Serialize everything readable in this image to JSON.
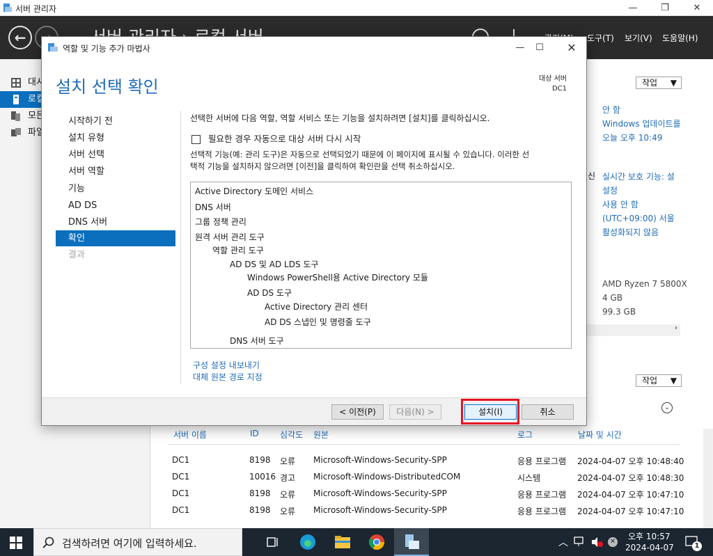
{
  "server_manager": {
    "title": "서버 관리자",
    "breadcrumb_visible": "서버 관리자 › 로컬 서버",
    "menu": [
      "관리(M)",
      "도구(T)",
      "보기(V)",
      "도움말(H)"
    ],
    "nav_items": [
      {
        "label": "대시",
        "icon": "dashboard-icon"
      },
      {
        "label": "로컬",
        "icon": "local-server-icon"
      },
      {
        "label": "모든",
        "icon": "all-servers-icon"
      },
      {
        "label": "파일",
        "icon": "file-services-icon"
      }
    ],
    "task_label": "작업",
    "properties": {
      "col_lines": [
        "안 함",
        "Windows 업데이트를",
        "오늘 오후 10:49"
      ],
      "col_lines_2_prefix": "신",
      "col_lines_2": [
        "실시간 보호 기능: 설",
        "설정",
        "사용 안 함",
        "(UTC+09:00) 서울",
        "활성화되지 않음"
      ],
      "hardware": [
        "AMD Ryzen 7 5800X",
        "4 GB",
        "99.3 GB"
      ]
    },
    "events": {
      "columns": [
        "서버 이름",
        "ID",
        "심각도",
        "원본",
        "로그",
        "날짜 및 시간"
      ],
      "rows": [
        [
          "DC1",
          "8198",
          "오류",
          "Microsoft-Windows-Security-SPP",
          "응용 프로그램",
          "2024-04-07 오후 10:48:40"
        ],
        [
          "DC1",
          "10016",
          "경고",
          "Microsoft-Windows-DistributedCOM",
          "시스템",
          "2024-04-07 오후 10:48:30"
        ],
        [
          "DC1",
          "8198",
          "오류",
          "Microsoft-Windows-Security-SPP",
          "응용 프로그램",
          "2024-04-07 오후 10:47:10"
        ],
        [
          "DC1",
          "8198",
          "오류",
          "Microsoft-Windows-Security-SPP",
          "응용 프로그램",
          "2024-04-07 오후 10:47:10"
        ]
      ]
    }
  },
  "wizard": {
    "title": "역할 및 기능 추가 마법사",
    "heading": "설치 선택 확인",
    "target_label": "대상 서버",
    "target_server": "DC1",
    "steps": [
      {
        "label": "시작하기 전",
        "state": "normal"
      },
      {
        "label": "설치 유형",
        "state": "normal"
      },
      {
        "label": "서버 선택",
        "state": "normal"
      },
      {
        "label": "서버 역할",
        "state": "normal"
      },
      {
        "label": "기능",
        "state": "normal"
      },
      {
        "label": "AD DS",
        "state": "normal"
      },
      {
        "label": "DNS 서버",
        "state": "normal"
      },
      {
        "label": "확인",
        "state": "active"
      },
      {
        "label": "결과",
        "state": "disabled"
      }
    ],
    "intro": "선택한 서버에 다음 역할, 역할 서비스 또는 기능을 설치하려면 [설치]를 클릭하십시오.",
    "restart_checkbox": "필요한 경우 자동으로 대상 서버 다시 시작",
    "restart_checked": false,
    "note_line1": "선택적 기능(예: 관리 도구)은 자동으로 선택되었기 때문에 이 페이지에 표시될 수 있습니다. 이러한 선",
    "note_line2": "택적 기능을 설치하지 않으려면 [이전]을 클릭하여 확인란을 선택 취소하십시오.",
    "items": [
      {
        "text": "Active Directory 도메인 서비스",
        "level": 0
      },
      {
        "text": "DNS 서버",
        "level": 0
      },
      {
        "text": "그룹 정책 관리",
        "level": 0
      },
      {
        "text": "원격 서버 관리 도구",
        "level": 0
      },
      {
        "text": "역할 관리 도구",
        "level": 1
      },
      {
        "text": "AD DS 및 AD LDS 도구",
        "level": 2
      },
      {
        "text": "Windows PowerShell용 Active Directory 모듈",
        "level": 3
      },
      {
        "text": "AD DS 도구",
        "level": 3
      },
      {
        "text": "Active Directory 관리 센터",
        "level": 4
      },
      {
        "text": "AD DS 스냅인 및 명령줄 도구",
        "level": 4
      },
      {
        "text": "DNS 서버 도구",
        "level": 2
      }
    ],
    "export_link": "구성 설정 내보내기",
    "alt_source_link": "대체 원본 경로 지정",
    "buttons": {
      "prev": "< 이전(P)",
      "next": "다음(N) >",
      "install": "설치(I)",
      "cancel": "취소"
    },
    "highlight_color": "#e81123"
  },
  "taskbar": {
    "search_placeholder": "검색하려면 여기에 입력하세요.",
    "time": "오후 10:57",
    "date": "2024-04-07",
    "notification_count": "1"
  },
  "colors": {
    "accent": "#0b6fbe",
    "link": "#1e6bb8",
    "header": "#2b2b2b"
  }
}
